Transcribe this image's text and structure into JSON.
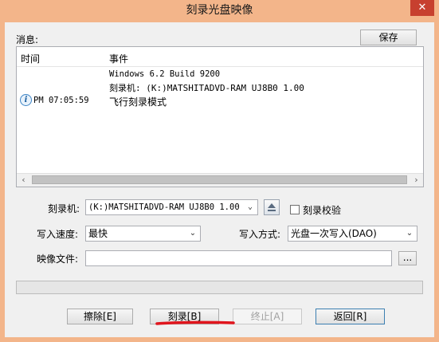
{
  "window": {
    "title": "刻录光盘映像",
    "close_glyph": "✕"
  },
  "messages": {
    "label": "消息:",
    "save_button": "保存",
    "columns": {
      "time": "时间",
      "event": "事件"
    },
    "entries": [
      {
        "time": "",
        "event": "Windows 6.2 Build 9200"
      },
      {
        "time": "",
        "event": "刻录机:  (K:)MATSHITADVD-RAM UJ8B0   1.00"
      },
      {
        "time": "PM 07:05:59",
        "event": "飞行刻录模式",
        "icon": "info-icon"
      }
    ]
  },
  "form": {
    "burner_label": "刻录机:",
    "burner_value": "(K:)MATSHITADVD-RAM UJ8B0   1.00",
    "verify_label": "刻录校验",
    "verify_checked": false,
    "speed_label": "写入速度:",
    "speed_value": "最快",
    "write_mode_label": "写入方式:",
    "write_mode_value": "光盘一次写入(DAO)",
    "image_file_label": "映像文件:",
    "image_file_value": "",
    "browse_button": "..."
  },
  "progress": {
    "value": 0
  },
  "buttons": {
    "erase": "擦除[E]",
    "burn": "刻录[B]",
    "stop": "终止[A]",
    "back": "返回[R]"
  },
  "colors": {
    "frame": "#f3b58a",
    "close": "#c7402f",
    "annotation": "#e0151d"
  }
}
